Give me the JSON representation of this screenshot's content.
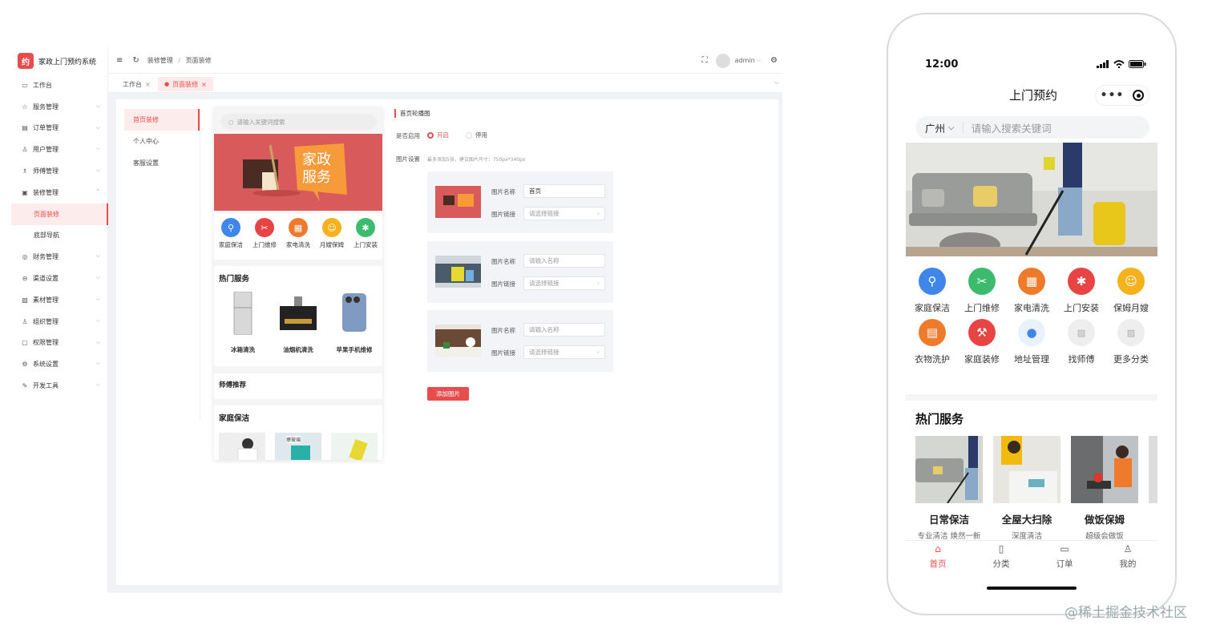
{
  "admin": {
    "logo_glyph": "约",
    "app_title": "家政上门预约系统",
    "menu": [
      {
        "icon": "monitor-icon",
        "label": "工作台",
        "expand": false
      },
      {
        "icon": "star-icon",
        "label": "服务管理",
        "expand": true
      },
      {
        "icon": "order-icon",
        "label": "订单管理",
        "expand": true
      },
      {
        "icon": "user-icon",
        "label": "用户管理",
        "expand": true
      },
      {
        "icon": "worker-icon",
        "label": "师傅管理",
        "expand": true
      },
      {
        "icon": "decorate-icon",
        "label": "装修管理",
        "expand": true,
        "open": true
      },
      {
        "label": "页面装修",
        "sub": true,
        "active": true
      },
      {
        "label": "底部导航",
        "sub": true
      },
      {
        "icon": "money-icon",
        "label": "财务管理",
        "expand": true
      },
      {
        "icon": "channel-icon",
        "label": "渠道设置",
        "expand": true
      },
      {
        "icon": "image-icon",
        "label": "素材管理",
        "expand": true
      },
      {
        "icon": "org-icon",
        "label": "组织管理",
        "expand": true
      },
      {
        "icon": "lock-icon",
        "label": "权限管理",
        "expand": true
      },
      {
        "icon": "gear-icon",
        "label": "系统设置",
        "expand": true
      },
      {
        "icon": "tool-icon",
        "label": "开发工具",
        "expand": true
      }
    ],
    "breadcrumb": [
      "装修管理",
      "页面装修"
    ],
    "breadcrumb_sep": "/",
    "user": "admin",
    "tabs": [
      {
        "label": "工作台",
        "active": false
      },
      {
        "label": "页面装修",
        "active": true
      }
    ],
    "subnav": [
      "首页装修",
      "个人中心",
      "客服设置"
    ],
    "preview": {
      "search_placeholder": "请输入关键词搜索",
      "banner_text_1": "家政",
      "banner_text_2": "服务",
      "icons": [
        {
          "label": "家庭保洁",
          "color": "#3e86e8"
        },
        {
          "label": "上门维修",
          "color": "#e84444"
        },
        {
          "label": "家电清洗",
          "color": "#f07a2c"
        },
        {
          "label": "月嫂保姆",
          "color": "#f5b21d"
        },
        {
          "label": "上门安装",
          "color": "#3dbb6c"
        }
      ],
      "hot_title": "热门服务",
      "hot_items": [
        "冰箱清洗",
        "油烟机清洗",
        "苹果手机维修"
      ],
      "master_title": "师傅推荐",
      "cleaning_title": "家庭保洁",
      "cleaning_label": "擦玻璃"
    },
    "form": {
      "section_title": "首页轮播图",
      "enable_label": "是否启用",
      "on_label": "开启",
      "off_label": "停用",
      "image_label": "图片设置",
      "image_hint": "最多添加5张，建议图片尺寸：750px*340px",
      "name_label": "图片名称",
      "link_label": "图片链接",
      "cards": [
        {
          "name_value": "首页",
          "name_placeholder": "请输入名称",
          "link_placeholder": "请选择链接"
        },
        {
          "name_value": "",
          "name_placeholder": "请输入名称",
          "link_placeholder": "请选择链接"
        },
        {
          "name_value": "",
          "name_placeholder": "请输入名称",
          "link_placeholder": "请选择链接"
        }
      ],
      "add_button": "添加图片"
    }
  },
  "phone": {
    "time": "12:00",
    "title": "上门预约",
    "city": "广州",
    "search_placeholder": "请输入搜索关键词",
    "grid": [
      {
        "label": "家庭保洁",
        "color": "#3e86e8",
        "icon": "broom-icon"
      },
      {
        "label": "上门维修",
        "color": "#3dbb6c",
        "icon": "wrench-icon"
      },
      {
        "label": "家电清洗",
        "color": "#f07a2c",
        "icon": "appliance-icon"
      },
      {
        "label": "上门安装",
        "color": "#e84444",
        "icon": "drill-icon"
      },
      {
        "label": "保姆月嫂",
        "color": "#f5b21d",
        "icon": "nanny-icon"
      },
      {
        "label": "衣物洗护",
        "color": "#f07a2c",
        "icon": "laundry-icon"
      },
      {
        "label": "家庭装修",
        "color": "#e84444",
        "icon": "hammer-icon"
      },
      {
        "label": "地址管理",
        "color": "#e9f1fc",
        "icon": "location-icon"
      },
      {
        "label": "找师傅",
        "color": "#eeeeee",
        "icon": "image-placeholder-icon"
      },
      {
        "label": "更多分类",
        "color": "#eeeeee",
        "icon": "image-placeholder-icon"
      }
    ],
    "hot_title": "热门服务",
    "hot": [
      {
        "title": "日常保洁",
        "sub": "专业清洁 焕然一新"
      },
      {
        "title": "全屋大扫除",
        "sub": "深度清洁"
      },
      {
        "title": "做饭保姆",
        "sub": "超级会做饭"
      }
    ],
    "nav": [
      {
        "label": "首页",
        "active": true,
        "icon": "home-icon"
      },
      {
        "label": "分类",
        "active": false,
        "icon": "category-icon"
      },
      {
        "label": "订单",
        "active": false,
        "icon": "order-icon"
      },
      {
        "label": "我的",
        "active": false,
        "icon": "profile-icon"
      }
    ]
  },
  "watermark": "@稀土掘金技术社区",
  "colors": {
    "accent": "#e84d4d",
    "bg": "#f0f2f5"
  }
}
